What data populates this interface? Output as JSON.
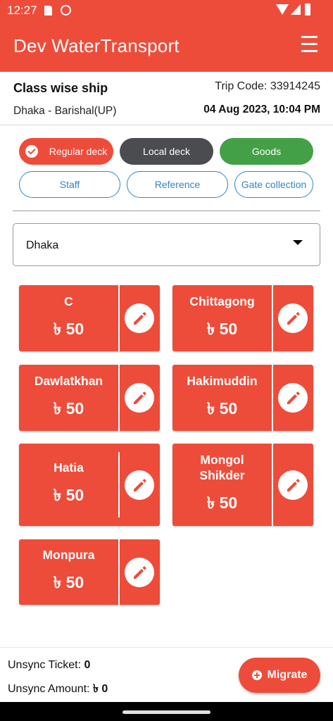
{
  "status_bar": {
    "time": "12:27"
  },
  "app_bar": {
    "title": "Dev WaterTransport"
  },
  "trip": {
    "class_label": "Class wise ship",
    "route": "Dhaka - Barishal(UP)",
    "trip_code": "Trip Code: 33914245",
    "datetime": "04 Aug 2023, 10:04 PM"
  },
  "chips": {
    "regular_deck": "Regular deck",
    "local_deck": "Local deck",
    "goods": "Goods",
    "staff": "Staff",
    "reference": "Reference",
    "gate_collection": "Gate collection"
  },
  "destination_select": {
    "value": "Dhaka"
  },
  "destinations": [
    {
      "name": "C",
      "price": "৳ 50"
    },
    {
      "name": "Chittagong",
      "price": "৳ 50"
    },
    {
      "name": "Dawlatkhan",
      "price": "৳ 50"
    },
    {
      "name": "Hakimuddin",
      "price": "৳ 50"
    },
    {
      "name": "Hatia",
      "price": "৳ 50"
    },
    {
      "name": "Mongol Shikder",
      "price": "৳ 50"
    },
    {
      "name": "Monpura",
      "price": "৳ 50"
    }
  ],
  "footer": {
    "unsync_ticket_label": "Unsync Ticket:",
    "unsync_ticket_value": "0",
    "unsync_amount_label": "Unsync Amount:",
    "unsync_amount_value": "৳ 0",
    "migrate_label": "Migrate"
  },
  "colors": {
    "primary": "#ee4c3a",
    "dark_chip": "#4b4c4f",
    "goods_chip": "#43a047",
    "outline_blue": "#2f86c6"
  }
}
